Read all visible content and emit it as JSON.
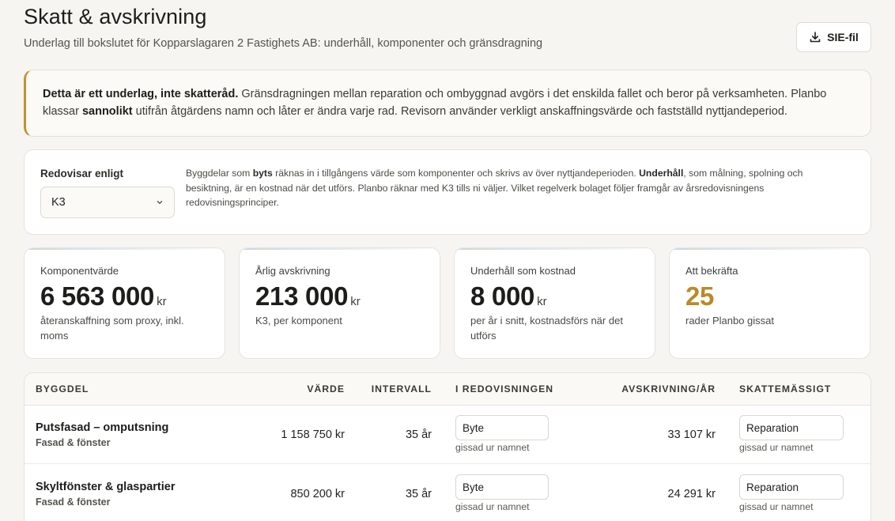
{
  "header": {
    "title": "Skatt & avskrivning",
    "subtitle": "Underlag till bokslutet för Kopparslagaren 2 Fastighets AB: underhåll, komponenter och gränsdragning",
    "sie_button_label": "SIE-fil"
  },
  "notice": {
    "strong_intro": "Detta är ett underlag, inte skatteråd.",
    "text_1": " Gränsdragningen mellan reparation och ombyggnad avgörs i det enskilda fallet och beror på verksamheten. Planbo klassar ",
    "strong_word": "sannolikt",
    "text_2": " utifrån åtgärdens namn och låter er ändra varje rad. Revisorn använder verkligt anskaffningsvärde och fastställd nyttjandeperiod."
  },
  "framework": {
    "label": "Redovisar enligt",
    "selected": "K3",
    "desc_1": "Byggdelar som ",
    "desc_strong_1": "byts",
    "desc_2": " räknas in i tillgångens värde som komponenter och skrivs av över nyttjandeperioden. ",
    "desc_strong_2": "Underhåll",
    "desc_3": ", som målning, spolning och besiktning, är en kostnad när det utförs. Planbo räknar med K3 tills ni väljer. Vilket regelverk bolaget följer framgår av årsredovisningens redovisningsprinciper."
  },
  "kpis": [
    {
      "label": "Komponentvärde",
      "value": "6 563 000",
      "unit": "kr",
      "caption": "återanskaffning som proxy, inkl. moms"
    },
    {
      "label": "Årlig avskrivning",
      "value": "213 000",
      "unit": "kr",
      "caption": "K3, per komponent"
    },
    {
      "label": "Underhåll som kostnad",
      "value": "8 000",
      "unit": "kr",
      "caption": "per år i snitt, kostnadsförs när det utförs"
    },
    {
      "label": "Att bekräfta",
      "value": "25",
      "unit": "",
      "caption": "rader Planbo gissat"
    }
  ],
  "table": {
    "headers": {
      "part": "BYGGDEL",
      "value": "VÄRDE",
      "interval": "INTERVALL",
      "accounting": "I REDOVISNINGEN",
      "depreciation": "AVSKRIVNING/ÅR",
      "tax": "SKATTEMÄSSIGT"
    },
    "rows": [
      {
        "name": "Putsfasad – omputsning",
        "category": "Fasad & fönster",
        "value": "1 158 750 kr",
        "interval": "35 år",
        "accounting": "Byte",
        "accounting_hint": "gissad ur namnet",
        "depreciation": "33 107 kr",
        "tax": "Reparation",
        "tax_hint": "gissad ur namnet"
      },
      {
        "name": "Skyltfönster & glaspartier",
        "category": "Fasad & fönster",
        "value": "850 200 kr",
        "interval": "35 år",
        "accounting": "Byte",
        "accounting_hint": "gissad ur namnet",
        "depreciation": "24 291 kr",
        "tax": "Reparation",
        "tax_hint": "gissad ur namnet"
      }
    ]
  }
}
